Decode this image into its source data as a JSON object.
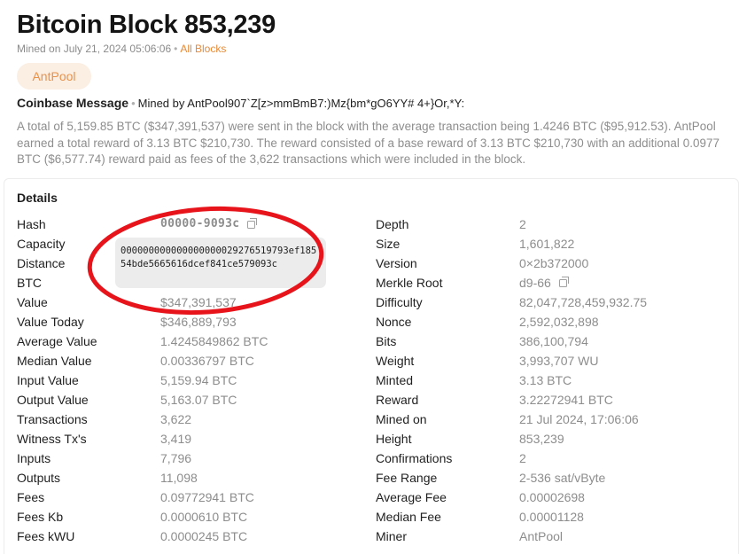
{
  "header": {
    "title": "Bitcoin Block",
    "block_number": "853,239",
    "mined_prefix": "Mined on July 21, 2024 05:06:06",
    "separator": "•",
    "all_blocks_link": "All Blocks"
  },
  "pool": {
    "badge": "AntPool"
  },
  "coinbase": {
    "label": "Coinbase Message",
    "separator": "•",
    "message": "Mined by AntPool907`Z[z>mmBmB7:)Mz{bm*gO6YY# 4+}Or,*Y:"
  },
  "summary": "A total of 5,159.85 BTC ($347,391,537) were sent in the block with the average transaction being 1.4246 BTC ($95,912.53). AntPool earned a total reward of 3.13 BTC $210,730. The reward consisted of a base reward of 3.13 BTC $210,730 with an additional 0.0977 BTC ($6,577.74) reward paid as fees of the 3,622 transactions which were included in the block.",
  "details": {
    "title": "Details",
    "hash_tooltip": "000000000000000000029276519793ef18554bde5665616dcef841ce579093c",
    "left": [
      {
        "key": "Hash",
        "value": "00000-9093c"
      },
      {
        "key": "Capacity",
        "value": ""
      },
      {
        "key": "Distance",
        "value": ""
      },
      {
        "key": "BTC",
        "value": ""
      },
      {
        "key": "Value",
        "value": "$347,391,537"
      },
      {
        "key": "Value Today",
        "value": "$346,889,793"
      },
      {
        "key": "Average Value",
        "value": "1.4245849862 BTC"
      },
      {
        "key": "Median Value",
        "value": "0.00336797 BTC"
      },
      {
        "key": "Input Value",
        "value": "5,159.94 BTC"
      },
      {
        "key": "Output Value",
        "value": "5,163.07 BTC"
      },
      {
        "key": "Transactions",
        "value": "3,622"
      },
      {
        "key": "Witness Tx's",
        "value": "3,419"
      },
      {
        "key": "Inputs",
        "value": "7,796"
      },
      {
        "key": "Outputs",
        "value": "11,098"
      },
      {
        "key": "Fees",
        "value": "0.09772941 BTC"
      },
      {
        "key": "Fees Kb",
        "value": "0.0000610 BTC"
      },
      {
        "key": "Fees kWU",
        "value": "0.0000245 BTC"
      }
    ],
    "right": [
      {
        "key": "Depth",
        "value": "2"
      },
      {
        "key": "Size",
        "value": "1,601,822"
      },
      {
        "key": "Version",
        "value": "0×2b372000"
      },
      {
        "key": "Merkle Root",
        "value": "d9-66"
      },
      {
        "key": "Difficulty",
        "value": "82,047,728,459,932.75"
      },
      {
        "key": "Nonce",
        "value": "2,592,032,898"
      },
      {
        "key": "Bits",
        "value": "386,100,794"
      },
      {
        "key": "Weight",
        "value": "3,993,707 WU"
      },
      {
        "key": "Minted",
        "value": "3.13 BTC"
      },
      {
        "key": "Reward",
        "value": "3.22272941 BTC"
      },
      {
        "key": "Mined on",
        "value": "21 Jul 2024, 17:06:06"
      },
      {
        "key": "Height",
        "value": "853,239"
      },
      {
        "key": "Confirmations",
        "value": "2"
      },
      {
        "key": "Fee Range",
        "value": "2-536 sat/vByte"
      },
      {
        "key": "Average Fee",
        "value": "0.00002698"
      },
      {
        "key": "Median Fee",
        "value": "0.00001128"
      },
      {
        "key": "Miner",
        "value": "AntPool"
      }
    ]
  },
  "colors": {
    "accent": "#e58a3c",
    "badge_bg": "#fbeee3",
    "muted_text": "#8d8d8d",
    "annotation_ring": "#e8141c"
  },
  "icons": [
    "copy-icon"
  ]
}
